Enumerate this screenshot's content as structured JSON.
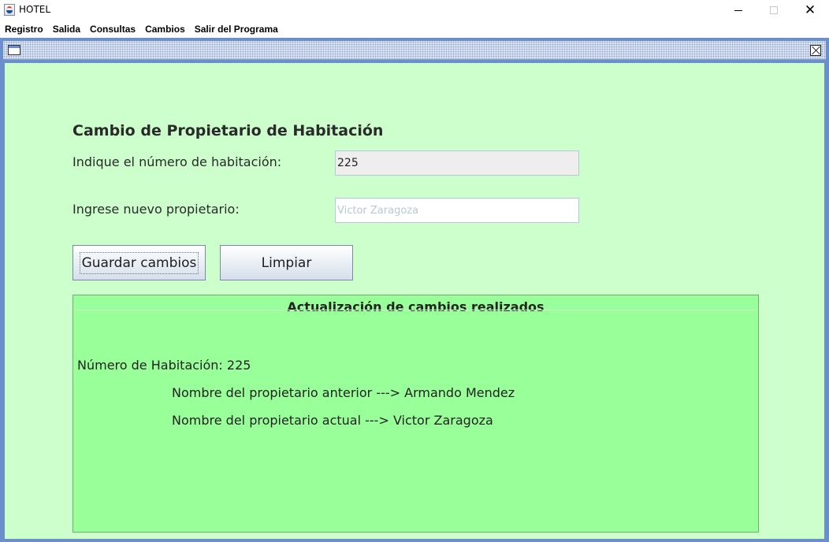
{
  "window": {
    "title": "HOTEL",
    "controls": {
      "minimize": "minimize",
      "maximize": "maximize",
      "close": "✕"
    }
  },
  "menu": {
    "items": [
      "Registro",
      "Salida",
      "Consultas",
      "Cambios",
      "Salir del Programa"
    ]
  },
  "form": {
    "heading": "Cambio de Propietario de Habitación",
    "room_label": "Indique el número de habitación:",
    "room_value": "225",
    "owner_label": "Ingrese nuevo propietario:",
    "owner_placeholder": "Victor Zaragoza",
    "save_button": "Guardar cambios",
    "clear_button": "Limpiar"
  },
  "results": {
    "title": "Actualización de cambios realizados",
    "room_line": "Número de Habitación: 225",
    "previous_owner_line": "Nombre del propietario anterior ---> Armando Mendez",
    "current_owner_line": "Nombre del propietario actual ---> Victor Zaragoza"
  },
  "colors": {
    "background": "#ccffcc",
    "results_panel": "#99ff99",
    "frame_border": "#6b8fc9"
  }
}
